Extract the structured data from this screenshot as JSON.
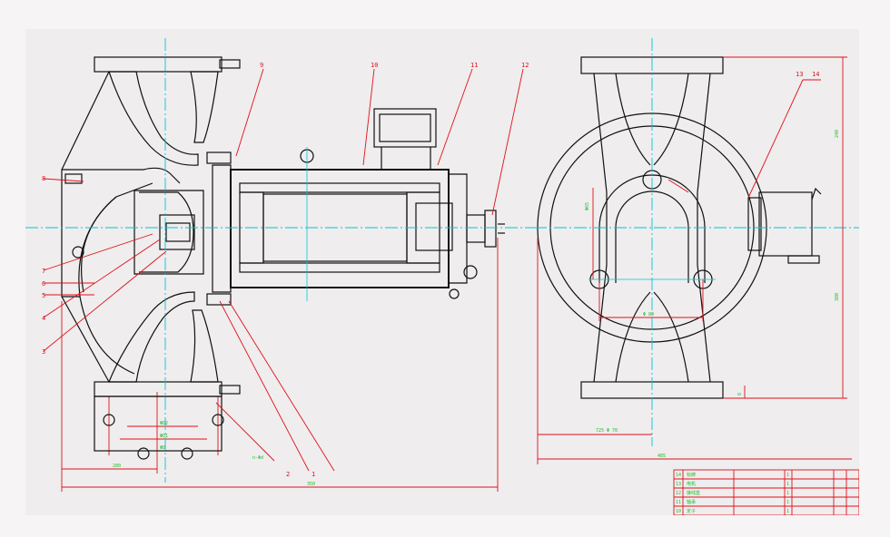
{
  "drawing": {
    "title": "",
    "part_numbers": [
      "1",
      "2",
      "3",
      "4",
      "5",
      "6",
      "7",
      "8",
      "9",
      "10",
      "11",
      "12",
      "13",
      "14"
    ],
    "dimensions": [
      "350",
      "380",
      "240",
      "Φ 70",
      "485",
      "ΦD",
      "ΦD1",
      "ΦD2",
      "n-Φd",
      "Φ 80",
      "8",
      "Φ65",
      "280",
      "725"
    ]
  },
  "title_block": {
    "rows": [
      [
        "14",
        "标牌",
        "1",
        "",
        ""
      ],
      [
        "13",
        "电机",
        "1",
        "",
        ""
      ],
      [
        "12",
        "接线盒",
        "1",
        "",
        ""
      ],
      [
        "11",
        "轴承",
        "1",
        "",
        ""
      ],
      [
        "10",
        "定子",
        "1",
        "",
        ""
      ]
    ]
  },
  "colors": {
    "outline": "#111111",
    "hatch": "#d23ad6",
    "dimension": "#e0101a",
    "center": "#00c8d4",
    "note": "#18c02a",
    "paper": "#efedee"
  }
}
